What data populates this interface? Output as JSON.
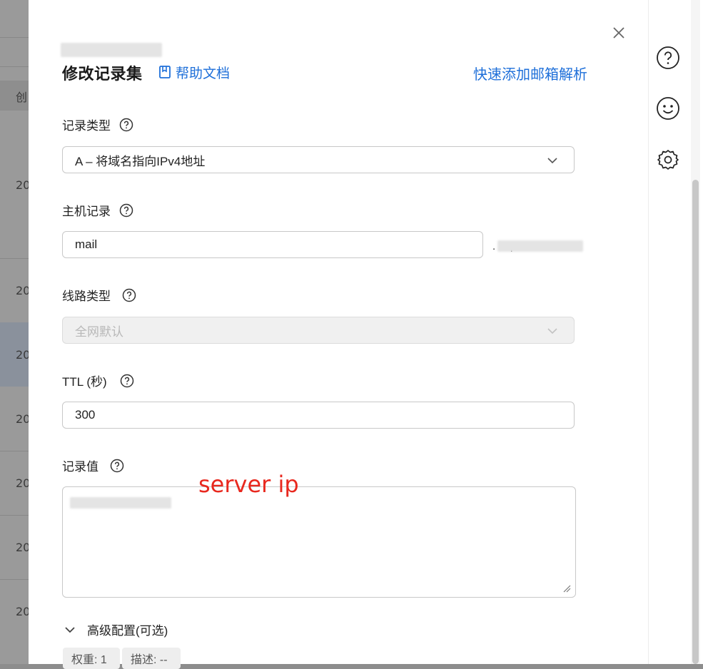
{
  "background": {
    "column_header": "创",
    "row_values": [
      "20",
      "20",
      "20",
      "20",
      "20",
      "20",
      "20"
    ]
  },
  "drawer": {
    "title": "修改记录集",
    "help_link": "帮助文档",
    "quick_add_link": "快速添加邮箱解析"
  },
  "form": {
    "record_type": {
      "label": "记录类型",
      "value": "A – 将域名指向IPv4地址"
    },
    "host": {
      "label": "主机记录",
      "value": "mail",
      "domain_suffix": ".     .top"
    },
    "line_type": {
      "label": "线路类型",
      "value": "全网默认",
      "disabled": true
    },
    "ttl": {
      "label": "TTL (秒)",
      "value": "300"
    },
    "record_value": {
      "label": "记录值",
      "annotation": "server ip"
    },
    "advanced": {
      "label": "高级配置(可选)"
    },
    "chips": [
      {
        "text": "权重: 1"
      },
      {
        "text": "描述: --"
      }
    ]
  },
  "icons": {
    "close": "close-icon",
    "help_doc": "book-icon",
    "question": "question-circle-icon",
    "chevron": "chevron-down-icon",
    "rail": [
      "question-circle-icon",
      "smiley-icon",
      "gear-icon"
    ]
  },
  "colors": {
    "link": "#1e6fd9",
    "annotation": "#e8281e",
    "disabled_bg": "#f0f0f0",
    "overlay": "#8d8d8d"
  }
}
